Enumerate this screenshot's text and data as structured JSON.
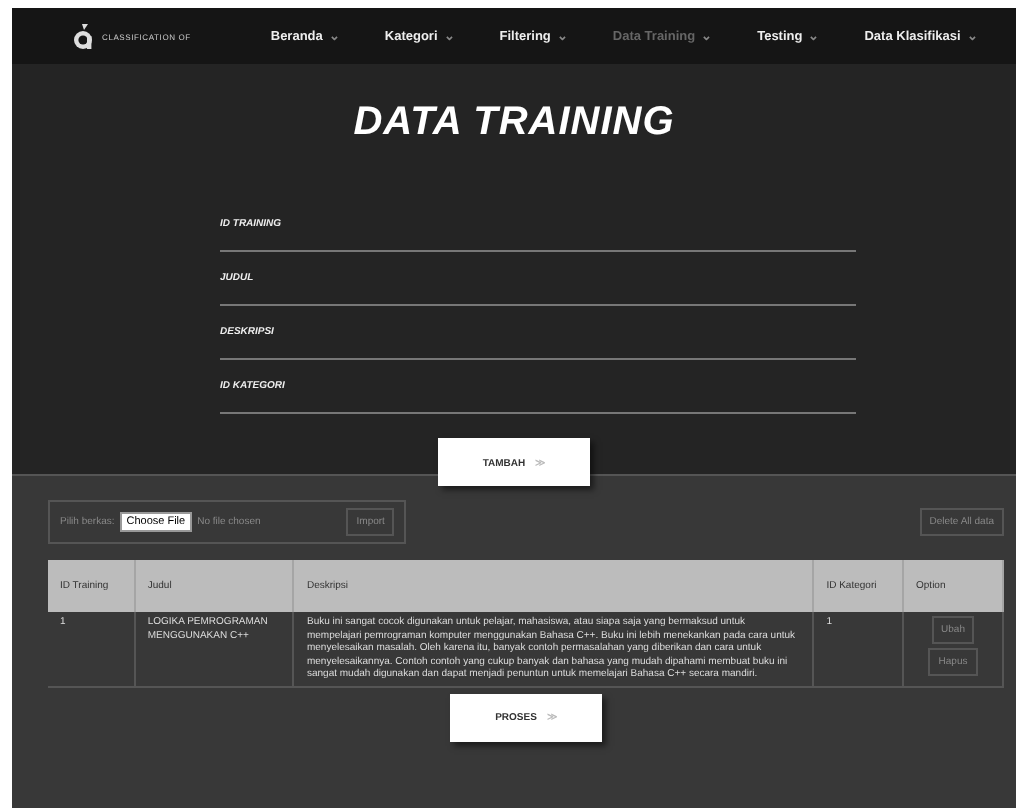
{
  "nav": {
    "logo_text": "CLASSIFICATION OF",
    "items": [
      {
        "label": "Beranda",
        "caret": "⌄",
        "selected": false
      },
      {
        "label": "Kategori",
        "caret": "⌄",
        "selected": false
      },
      {
        "label": "Filtering",
        "caret": "⌄",
        "selected": false
      },
      {
        "label": "Data Training",
        "caret": "⌄",
        "selected": true
      },
      {
        "label": "Testing",
        "caret": "⌄",
        "selected": false
      },
      {
        "label": "Data Klasifikasi",
        "caret": "⌄",
        "selected": false
      }
    ]
  },
  "title": "DATA TRAINING",
  "form": {
    "fields": [
      {
        "label": "ID TRAINING"
      },
      {
        "label": "JUDUL"
      },
      {
        "label": "DESKRIPSI"
      },
      {
        "label": "ID KATEGORI"
      }
    ],
    "submit": {
      "label": "TAMBAH",
      "arrow": "≫"
    }
  },
  "import": {
    "label": "Pilih berkas:",
    "file_button": "Choose File",
    "file_status": "No file chosen",
    "import_button": "Import"
  },
  "delete_all": "Delete All data",
  "table": {
    "columns": [
      "ID Training",
      "Judul",
      "Deskripsi",
      "ID Kategori",
      "Option"
    ],
    "rows": [
      {
        "id": "1",
        "judul": "LOGIKA PEMROGRAMAN MENGGUNAKAN C++",
        "deskripsi": "Buku ini sangat cocok digunakan untuk pelajar, mahasiswa, atau siapa saja yang bermaksud untuk mempelajari pemrograman komputer menggunakan Bahasa C++. Buku ini lebih menekankan pada cara untuk menyelesaikan masalah. Oleh karena itu, banyak contoh permasalahan yang diberikan dan cara untuk menyelesaikannya. Contoh contoh yang cukup banyak dan bahasa yang mudah dipahami membuat buku ini sangat mudah digunakan dan dapat menjadi penuntun untuk memelajari Bahasa C++ secara mandiri.",
        "id_kategori": "1",
        "actions": [
          "Ubah",
          "Hapus"
        ]
      }
    ]
  },
  "process": {
    "label": "PROSES",
    "arrow": "≫"
  }
}
